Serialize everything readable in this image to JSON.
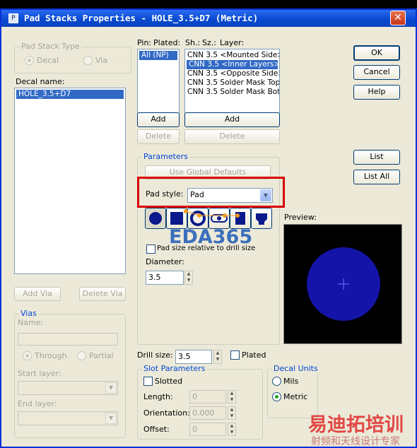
{
  "window": {
    "title": "Pad Stacks Properties - HOLE_3.5+D7 (Metric)",
    "close_glyph": "✕"
  },
  "pad_stack_type": {
    "title": "Pad Stack Type",
    "decal": "Decal",
    "via": "Via"
  },
  "decal": {
    "label": "Decal name:",
    "items": [
      "HOLE_3.5+D7"
    ]
  },
  "add_via": "Add Via",
  "delete_via": "Delete Via",
  "vias": {
    "title": "Vias",
    "name_label": "Name:",
    "through": "Through",
    "partial": "Partial",
    "start_layer": "Start layer:",
    "end_layer": "End layer:"
  },
  "pin_headers": {
    "pin": "Pin:",
    "plated": "Plated:",
    "sh": "Sh.:",
    "sz": "Sz.:",
    "layer": "Layer:"
  },
  "pins": [
    "All (NP)"
  ],
  "layers": [
    "CNN 3.5 <Mounted Side>",
    "CNN 3.5 <Inner Layers>",
    "CNN 3.5 <Opposite Side>",
    "CNN 3.5 Solder Mask Top",
    "CNN 3.5 Solder Mask Bottom"
  ],
  "pin_add": "Add",
  "pin_delete": "Delete",
  "layer_add": "Add",
  "layer_delete": "Delete",
  "parameters": {
    "title": "Parameters",
    "use_global": "Use Global Defaults",
    "pad_style_label": "Pad style:",
    "pad_style_value": "Pad",
    "pad_size_relative": "Pad size relative to drill size",
    "diameter_label": "Diameter:",
    "diameter_value": "3.5"
  },
  "preview_label": "Preview:",
  "buttons": {
    "ok": "OK",
    "cancel": "Cancel",
    "help": "Help",
    "list": "List",
    "list_all": "List All"
  },
  "drill": {
    "label": "Drill size:",
    "value": "3.5",
    "plated": "Plated"
  },
  "slot": {
    "title": "Slot Parameters",
    "slotted": "Slotted",
    "length_label": "Length:",
    "length_value": "0",
    "orientation_label": "Orientation:",
    "orientation_value": "0.000",
    "offset_label": "Offset:",
    "offset_value": "0"
  },
  "decal_units": {
    "title": "Decal Units",
    "mils": "Mils",
    "metric": "Metric",
    "selected": "metric"
  },
  "watermark": {
    "line1": "EDA365",
    "line2": "易迪拓培训",
    "line3": "射频和天线设计专家"
  },
  "colors": {
    "title_bar": "#0a4ad0",
    "highlight": "#d80000",
    "selection": "#316ac5",
    "preview_pad": "#1414a8"
  }
}
